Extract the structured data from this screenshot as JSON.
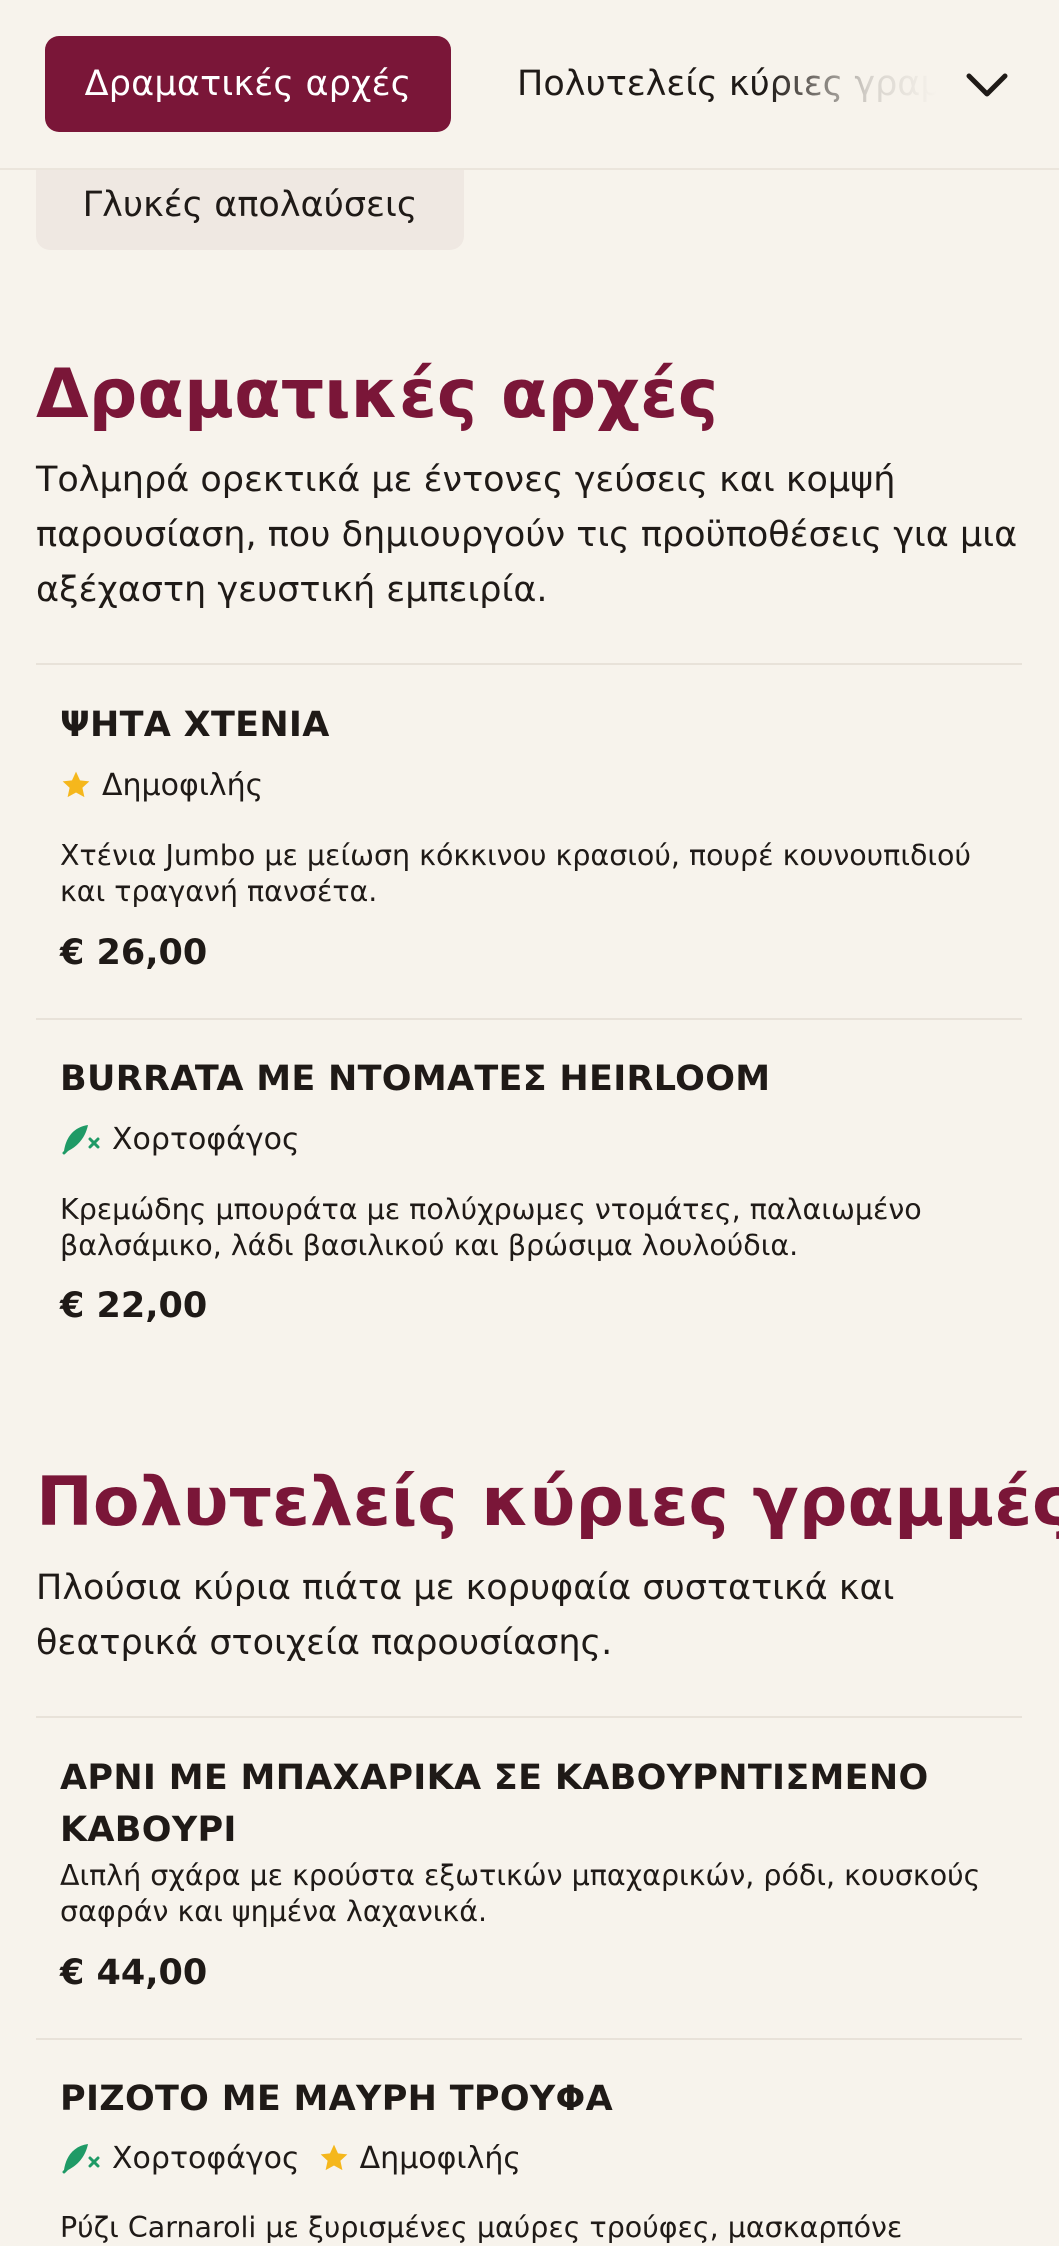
{
  "nav": {
    "active_tab": "Δραματικές αρχές",
    "next_tab": "Πολυτελείς κύριες γραμμές",
    "secondary_tab": "Γλυκές απολαύσεις"
  },
  "badge_labels": {
    "popular": "Δημοφιλής",
    "vegetarian": "Χορτοφάγος"
  },
  "sections": [
    {
      "title": "Δραματικές αρχές",
      "description": "Τολμηρά ορεκτικά με έντονες γεύσεις και κομψή παρουσίαση, που δημιουργούν τις προϋποθέσεις για μια αξέχαστη γευστική εμπειρία.",
      "items": [
        {
          "name": "ΨΗΤΑ ΧΤΕΝΙΑ",
          "badges": [
            "popular"
          ],
          "description": "Χτένια Jumbo με μείωση κόκκινου κρασιού, πουρέ κουνουπιδιού και τραγανή πανσέτα.",
          "price": "€ 26,00"
        },
        {
          "name": "BURRATA ΜΕ ΝΤΟΜΑΤΕΣ HEIRLOOM",
          "badges": [
            "vegetarian"
          ],
          "description": "Κρεμώδης μπουράτα με πολύχρωμες ντομάτες, παλαιωμένο βαλσάμικο, λάδι βασιλικού και βρώσιμα λουλούδια.",
          "price": "€ 22,00"
        }
      ]
    },
    {
      "title": "Πολυτελείς κύριες γραμμές",
      "description": "Πλούσια κύρια πιάτα με κορυφαία συστατικά και θεατρικά στοιχεία παρουσίασης.",
      "items": [
        {
          "name": "ΑΡΝΙ ΜΕ ΜΠΑΧΑΡΙΚΑ ΣΕ ΚΑΒΟΥΡΝΤΙΣΜΕΝΟ ΚΑΒΟΥΡΙ",
          "badges": [],
          "description": "Διπλή σχάρα με κρούστα εξωτικών μπαχαρικών, ρόδι, κουσκούς σαφράν και ψημένα λαχανικά.",
          "price": "€ 44,00"
        },
        {
          "name": "ΡΙΖΟΤΟ ΜΕ ΜΑΥΡΗ ΤΡΟΥΦΑ",
          "badges": [
            "vegetarian",
            "popular"
          ],
          "description": "Ρύζι Carnaroli με ξυρισμένες μαύρες τρούφες, μασκαρπόνε",
          "price": ""
        }
      ]
    }
  ],
  "icons": {
    "popular": "star-icon",
    "vegetarian": "leaf-icon",
    "dropdown": "chevron-down-icon"
  },
  "colors": {
    "accent": "#7a1638",
    "star": "#f5b71c",
    "vegetarian": "#1f9a66",
    "background": "#f7f3ec"
  }
}
